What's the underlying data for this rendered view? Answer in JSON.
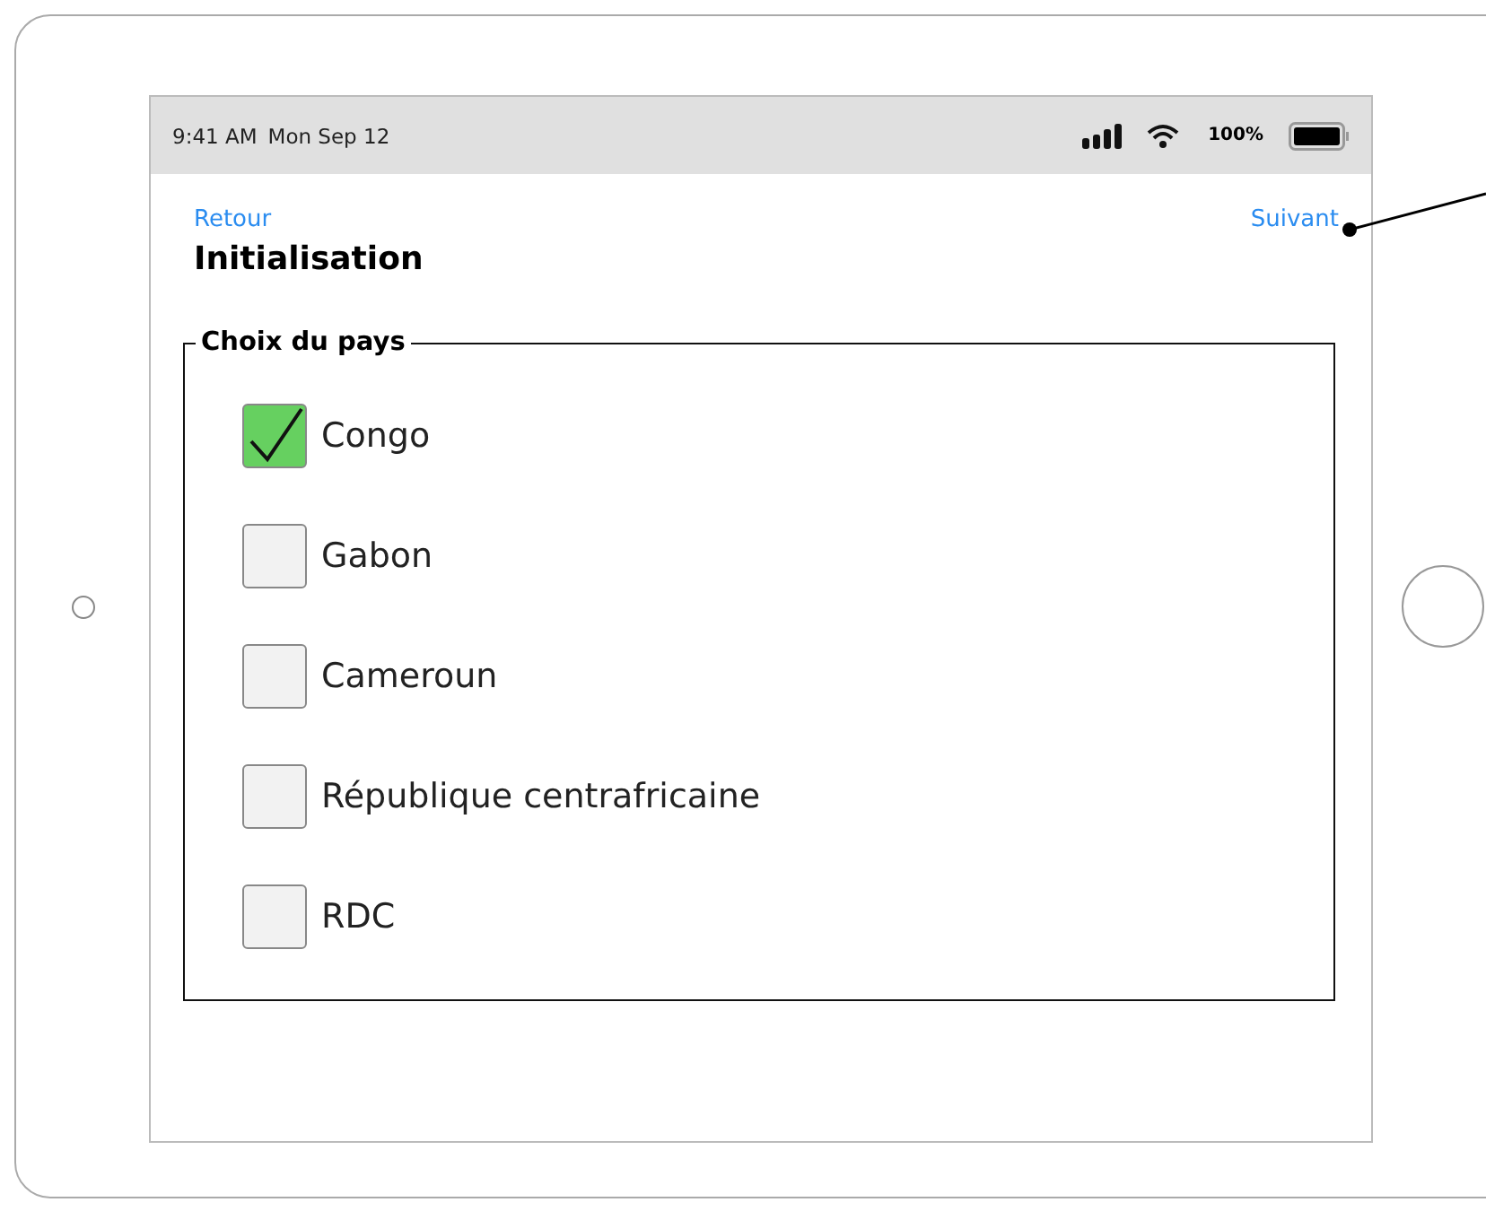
{
  "status_bar": {
    "time": "9:41 AM",
    "date": "Mon Sep 12",
    "battery": "100%"
  },
  "nav": {
    "back": "Retour",
    "next": "Suivant",
    "title": "Initialisation"
  },
  "group": {
    "legend": "Choix du pays",
    "options": [
      {
        "label": "Congo",
        "checked": true
      },
      {
        "label": "Gabon",
        "checked": false
      },
      {
        "label": "Cameroun",
        "checked": false
      },
      {
        "label": "République centrafricaine",
        "checked": false
      },
      {
        "label": "RDC",
        "checked": false
      }
    ]
  }
}
